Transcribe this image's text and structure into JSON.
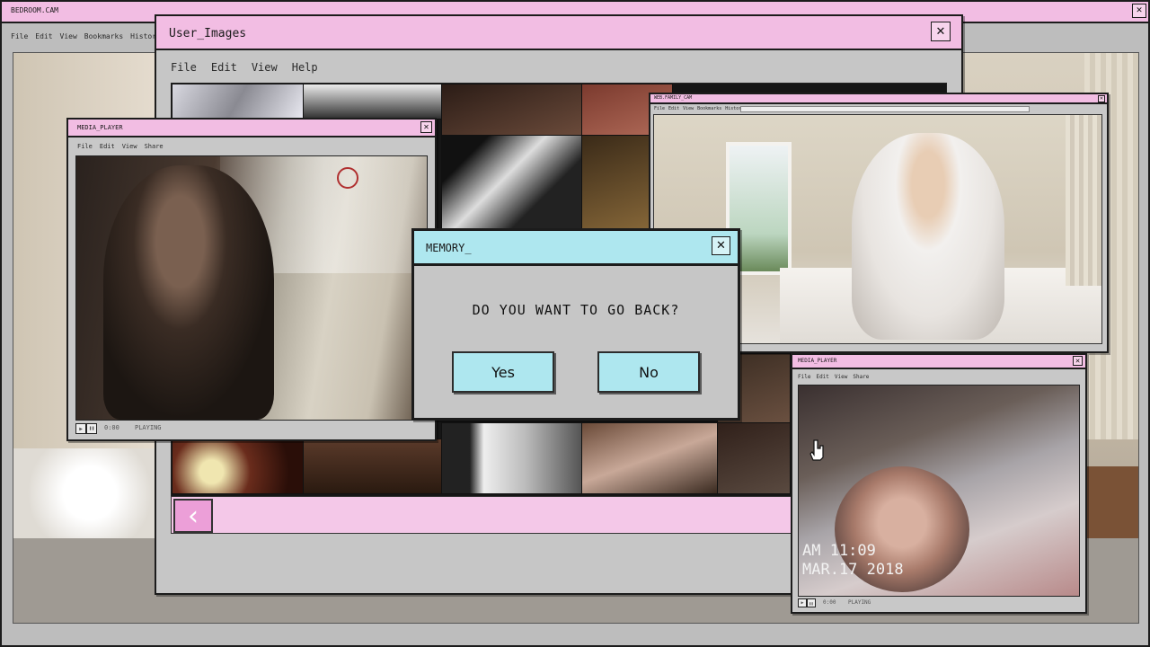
{
  "bedroom_cam": {
    "title": "BEDROOM.CAM",
    "close_glyph": "✕",
    "menu": [
      "File",
      "Edit",
      "View",
      "Bookmarks",
      "History"
    ]
  },
  "user_images": {
    "title": "User_Images",
    "close_glyph": "✕",
    "menu": [
      "File",
      "Edit",
      "View",
      "Help"
    ],
    "back_arrow": "‹"
  },
  "media_player_left": {
    "title": "MEDIA_PLAYER",
    "close_glyph": "✕",
    "menu": [
      "File",
      "Edit",
      "View",
      "Share"
    ],
    "play_glyph": "▶",
    "pause_glyph": "❚❚",
    "time": "0:00",
    "status": "PLAYING"
  },
  "webcam": {
    "title": "WEB.FAMILY_CAM",
    "close_glyph": "✕",
    "menu": [
      "File",
      "Edit",
      "View",
      "Bookmarks",
      "History"
    ]
  },
  "media_player_right": {
    "title": "MEDIA_PLAYER",
    "close_glyph": "✕",
    "menu": [
      "File",
      "Edit",
      "View",
      "Share"
    ],
    "play_glyph": "▶",
    "pause_glyph": "❚❚",
    "time": "0:00",
    "status": "PLAYING",
    "timestamp_time": "AM 11:09",
    "timestamp_date": "MAR.17 2018"
  },
  "dialog": {
    "title": "MEMORY_",
    "close_glyph": "✕",
    "question": "DO YOU WANT TO GO BACK?",
    "yes_label": "Yes",
    "no_label": "No"
  },
  "icons": [
    "close-icon",
    "chevron-left-icon",
    "play-icon",
    "pause-icon",
    "pointer-cursor-icon",
    "no-smoking-icon"
  ],
  "colors": {
    "window_title_pink": "#f2bde3",
    "dialog_title_cyan": "#aee7ef",
    "button_cyan": "#aee7ef",
    "window_body_gray": "#c6c6c6"
  }
}
